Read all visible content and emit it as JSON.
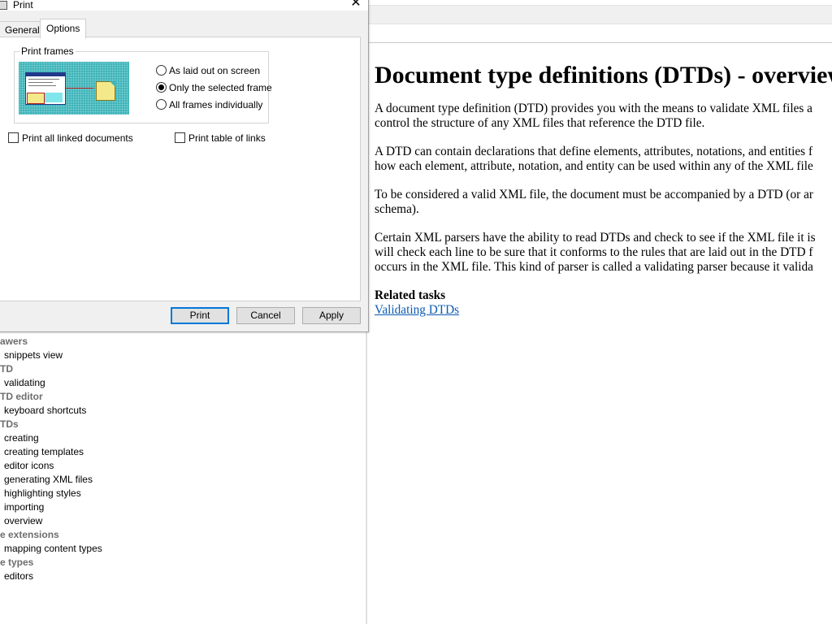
{
  "dialog": {
    "title": "Print",
    "close_glyph": "✕",
    "tabs": [
      {
        "label": "General",
        "selected": false
      },
      {
        "label": "Options",
        "selected": true
      }
    ],
    "print_frames": {
      "legend": "Print frames",
      "options": [
        {
          "label": "As laid out on screen",
          "selected": false
        },
        {
          "label": "Only the selected frame",
          "selected": true
        },
        {
          "label": "All frames individually",
          "selected": false
        }
      ]
    },
    "checkboxes": [
      {
        "label": "Print all linked documents",
        "checked": false
      },
      {
        "label": "Print table of links",
        "checked": false
      }
    ],
    "buttons": {
      "print": "Print",
      "cancel": "Cancel",
      "apply": "Apply"
    }
  },
  "index": {
    "items": [
      {
        "text": "awers",
        "type": "heading"
      },
      {
        "text": "snippets view",
        "type": "entry"
      },
      {
        "text": "TD",
        "type": "heading"
      },
      {
        "text": "validating",
        "type": "entry"
      },
      {
        "text": "TD editor",
        "type": "heading"
      },
      {
        "text": "keyboard shortcuts",
        "type": "entry"
      },
      {
        "text": "TDs",
        "type": "heading"
      },
      {
        "text": "creating",
        "type": "entry"
      },
      {
        "text": "creating templates",
        "type": "entry"
      },
      {
        "text": "editor icons",
        "type": "entry"
      },
      {
        "text": "generating XML files",
        "type": "entry"
      },
      {
        "text": "highlighting styles",
        "type": "entry"
      },
      {
        "text": "importing",
        "type": "entry"
      },
      {
        "text": "overview",
        "type": "entry"
      },
      {
        "text": "e extensions",
        "type": "heading"
      },
      {
        "text": "mapping content types",
        "type": "entry"
      },
      {
        "text": "e types",
        "type": "heading"
      },
      {
        "text": "editors",
        "type": "entry"
      }
    ]
  },
  "document": {
    "title": "Document type definitions (DTDs) - overview",
    "paragraphs": [
      [
        "A document type definition (DTD) provides you with the means to validate XML files a",
        "control the structure of any XML files that reference the DTD file."
      ],
      [
        "A DTD can contain declarations that define elements, attributes, notations, and entities f",
        "how each element, attribute, notation, and entity can be used within any of the XML file"
      ],
      [
        "To be considered a valid XML file, the document must be accompanied by a DTD (or ar",
        "schema)."
      ],
      [
        "Certain XML parsers have the ability to read DTDs and check to see if the XML file it is",
        "will check each line to be sure that it conforms to the rules that are laid out in the DTD f",
        "occurs in the XML file. This kind of parser is called a validating parser because it valida"
      ]
    ],
    "related_heading": "Related tasks",
    "related_link": "Validating DTDs"
  }
}
